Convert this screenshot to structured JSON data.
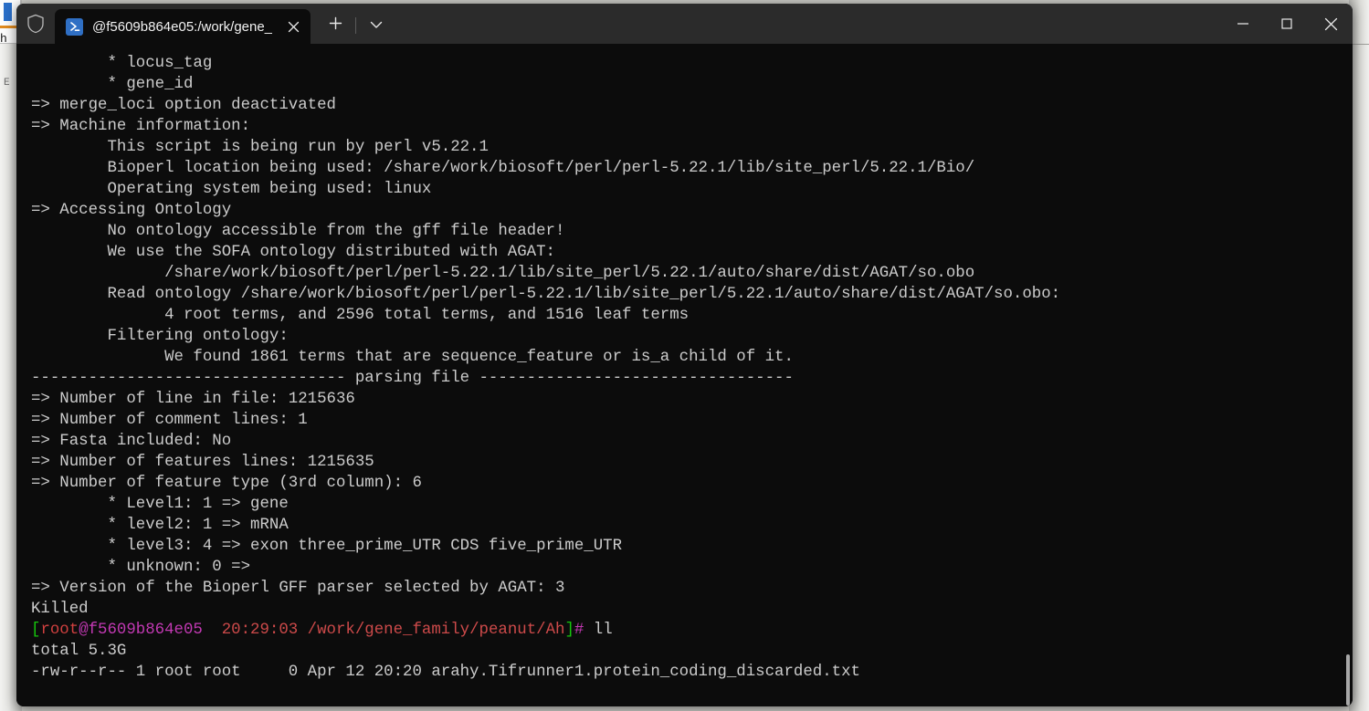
{
  "window": {
    "shield_icon": "shield-icon",
    "controls": {
      "minimize": "minimize-icon",
      "maximize": "maximize-icon",
      "close": "close-icon"
    }
  },
  "tabbar": {
    "tab": {
      "icon": "powershell-prompt-icon",
      "title": "@f5609b864e05:/work/gene_",
      "close_icon": "close-icon"
    },
    "new_tab_icon": "plus-icon",
    "dropdown_icon": "chevron-down-icon"
  },
  "background_window": {
    "letter": "h",
    "small_letter": "E"
  },
  "terminal": {
    "lines": [
      {
        "id": "l01",
        "text": "        * locus_tag"
      },
      {
        "id": "l02",
        "text": "        * gene_id"
      },
      {
        "id": "l03",
        "text": "=> merge_loci option deactivated"
      },
      {
        "id": "l04",
        "text": "=> Machine information:"
      },
      {
        "id": "l05",
        "text": "        This script is being run by perl v5.22.1"
      },
      {
        "id": "l06",
        "text": "        Bioperl location being used: /share/work/biosoft/perl/perl-5.22.1/lib/site_perl/5.22.1/Bio/"
      },
      {
        "id": "l07",
        "text": "        Operating system being used: linux"
      },
      {
        "id": "l08",
        "text": "=> Accessing Ontology"
      },
      {
        "id": "l09",
        "text": "        No ontology accessible from the gff file header!"
      },
      {
        "id": "l10",
        "text": "        We use the SOFA ontology distributed with AGAT:"
      },
      {
        "id": "l11",
        "text": "              /share/work/biosoft/perl/perl-5.22.1/lib/site_perl/5.22.1/auto/share/dist/AGAT/so.obo"
      },
      {
        "id": "l12",
        "text": "        Read ontology /share/work/biosoft/perl/perl-5.22.1/lib/site_perl/5.22.1/auto/share/dist/AGAT/so.obo:"
      },
      {
        "id": "l13",
        "text": "              4 root terms, and 2596 total terms, and 1516 leaf terms"
      },
      {
        "id": "l14",
        "text": "        Filtering ontology:"
      },
      {
        "id": "l15",
        "text": "              We found 1861 terms that are sequence_feature or is_a child of it."
      },
      {
        "id": "l16",
        "text": "--------------------------------- parsing file ---------------------------------"
      },
      {
        "id": "l17",
        "text": "=> Number of line in file: 1215636"
      },
      {
        "id": "l18",
        "text": "=> Number of comment lines: 1"
      },
      {
        "id": "l19",
        "text": "=> Fasta included: No"
      },
      {
        "id": "l20",
        "text": "=> Number of features lines: 1215635"
      },
      {
        "id": "l21",
        "text": "=> Number of feature type (3rd column): 6"
      },
      {
        "id": "l22",
        "text": "        * Level1: 1 => gene"
      },
      {
        "id": "l23",
        "text": "        * level2: 1 => mRNA"
      },
      {
        "id": "l24",
        "text": "        * level3: 4 => exon three_prime_UTR CDS five_prime_UTR"
      },
      {
        "id": "l25",
        "text": "        * unknown: 0 =>"
      },
      {
        "id": "l26",
        "text": "=> Version of the Bioperl GFF parser selected by AGAT: 3"
      },
      {
        "id": "l27",
        "text": "Killed"
      }
    ],
    "prompt": {
      "bracket_open": "[",
      "user": "root",
      "host": "@f5609b864e05",
      "spacer": "  ",
      "time": "20:29:03",
      "path": " /work/gene_family/peanut/Ah",
      "bracket_close": "]",
      "hash": "#",
      "command": " ll"
    },
    "after_prompt": [
      {
        "id": "a01",
        "text": "total 5.3G"
      },
      {
        "id": "a02",
        "text": "-rw-r--r-- 1 root root     0 Apr 12 20:20 arahy.Tifrunner1.protein_coding_discarded.txt"
      }
    ]
  },
  "colors": {
    "terminal_bg": "#0c0c0c",
    "terminal_fg": "#cccccc",
    "titlebar_bg": "#2b2b2b",
    "prompt_green": "#16c60c",
    "prompt_red": "#d0403f",
    "prompt_magenta": "#c239b3",
    "prompt_salmon": "#cd4a4a",
    "tab_icon_blue": "#2f6fc4"
  }
}
